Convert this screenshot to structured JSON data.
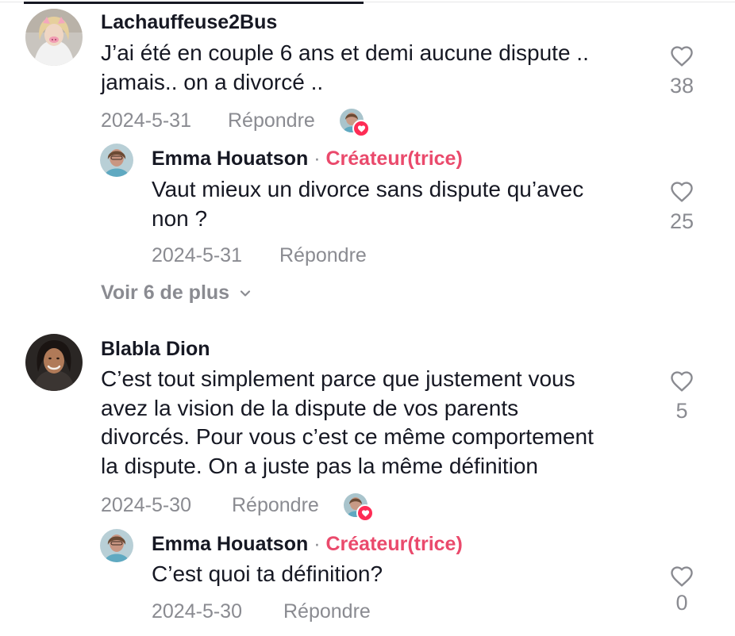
{
  "comments": [
    {
      "username": "Lachauffeuse2Bus",
      "text_lines": [
        "J’ai été en couple 6 ans et demi aucune dispute ..",
        "jamais.. on a divorcé .."
      ],
      "date": "2024-5-31",
      "reply_label": "Répondre",
      "likes": "38",
      "reply": {
        "username": "Emma Houatson",
        "separator": "·",
        "creator_badge": "Créateur(trice)",
        "text_lines": [
          "Vaut mieux un divorce sans dispute qu’avec",
          "non ?"
        ],
        "date": "2024-5-31",
        "reply_label": "Répondre",
        "likes": "25"
      },
      "view_more": "Voir 6 de plus"
    },
    {
      "username": "Blabla Dion",
      "text_lines": [
        "C’est tout simplement parce que justement vous",
        "avez la vision de la dispute de vos parents",
        "divorcés. Pour vous c’est ce même comportement",
        "la dispute. On a juste pas la même définition"
      ],
      "date": "2024-5-30",
      "reply_label": "Répondre",
      "likes": "5",
      "reply": {
        "username": "Emma Houatson",
        "separator": "·",
        "creator_badge": "Créateur(trice)",
        "text_lines": [
          "C’est quoi ta définition?"
        ],
        "date": "2024-5-30",
        "reply_label": "Répondre",
        "likes": "0"
      }
    }
  ],
  "icons": {
    "like": "heart-outline-icon",
    "creator_liked_badge": "heart-badge-icon",
    "expand": "chevron-down-icon"
  },
  "colors": {
    "text": "#161823",
    "muted": "#8a8b91",
    "creator": "#ea4a6c",
    "like_badge": "#fe2c55"
  }
}
